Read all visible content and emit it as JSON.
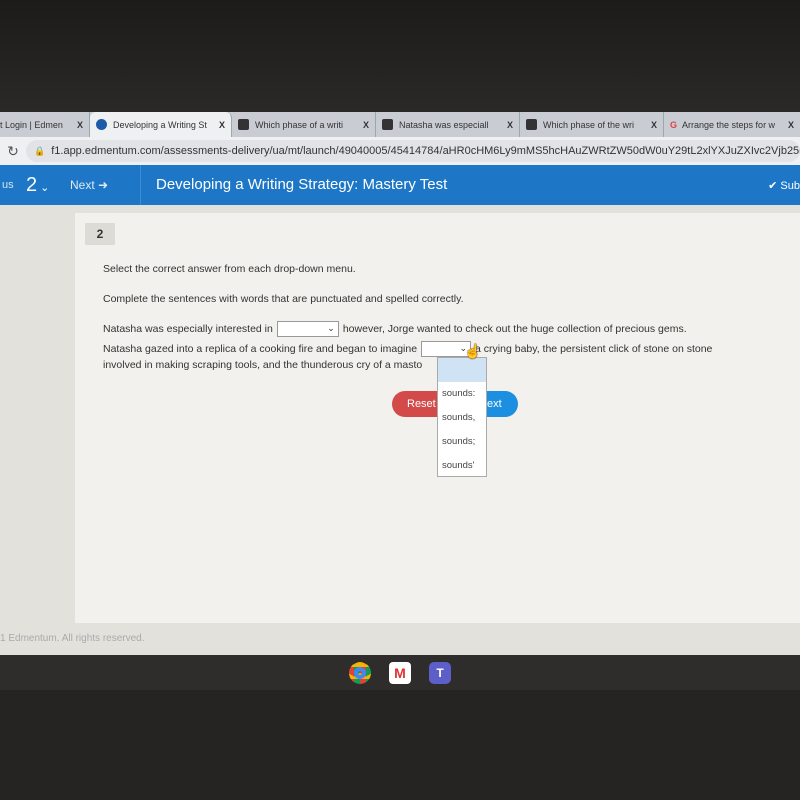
{
  "browser": {
    "tabs": [
      {
        "label": "t Login | Edmen",
        "active": false
      },
      {
        "label": "Developing a Writing St",
        "active": true
      },
      {
        "label": "Which phase of a writi",
        "active": false
      },
      {
        "label": "Natasha was especiall",
        "active": false
      },
      {
        "label": "Which phase of the wri",
        "active": false
      },
      {
        "label": "Arrange the steps for w",
        "active": false
      }
    ],
    "close_glyph": "X",
    "url": "f1.app.edmentum.com/assessments-delivery/ua/mt/launch/49040005/45414784/aHR0cHM6Ly9mMS5hcHAuZWRtZW50dW0uY29tL2xlYXJuZXIvc2Vjb25kYX"
  },
  "header": {
    "left_cut": "us",
    "question_number": "2",
    "next_label": "Next",
    "title": "Developing a Writing Strategy: Mastery Test",
    "submit_cut": "Sub",
    "color": "#1d77c6"
  },
  "question": {
    "number": "2",
    "instruction1": "Select the correct answer from each drop-down menu.",
    "instruction2": "Complete the sentences with words that are punctuated and spelled correctly.",
    "line1_before": "Natasha was especially interested in",
    "line1_after": "however, Jorge wanted to check out the huge collection of precious gems.",
    "line2_before": "Natasha gazed into a replica of a cooking fire and began to imagine",
    "line2_after": "a crying baby, the persistent click of stone on stone",
    "line3": "involved in making scraping tools, and the thunderous cry of a masto",
    "dropdown_options": [
      "sounds:",
      "sounds,",
      "sounds;",
      "sounds'"
    ],
    "reset_label": "Reset",
    "next_label_cut": "ext"
  },
  "footer": "1 Edmentum. All rights reserved.",
  "taskbar": [
    "chrome-icon",
    "gmail-icon",
    "teams-icon"
  ]
}
